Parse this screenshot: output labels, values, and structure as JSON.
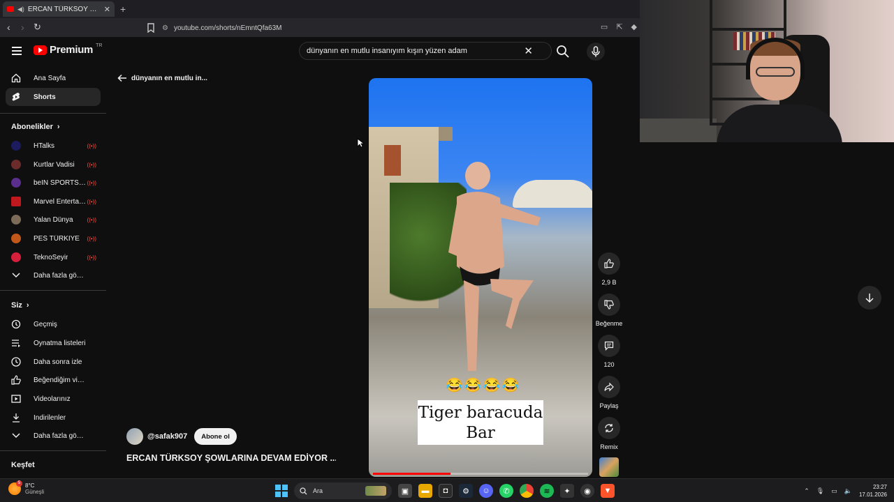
{
  "browser": {
    "tab_title": "ERCAN TÜRKSOY ŞOWLARINA",
    "url": "youtube.com/shorts/nEmntQfa63M"
  },
  "header": {
    "logo_text": "Premium",
    "logo_region": "TR",
    "search_value": "dünyanın en mutlu insanıyım kışın yüzen adam"
  },
  "sidebar": {
    "main": [
      {
        "label": "Ana Sayfa"
      },
      {
        "label": "Shorts"
      }
    ],
    "subs_heading": "Abonelikler",
    "subscriptions": [
      {
        "label": "HTalks",
        "color": "#1b1b5e"
      },
      {
        "label": "Kurtlar Vadisi",
        "color": "#6b2b2b"
      },
      {
        "label": "beIN SPORTS TÜ...",
        "color": "#5a2e8c"
      },
      {
        "label": "Marvel Entertain...",
        "color": "#c0181f"
      },
      {
        "label": "Yalan Dünya",
        "color": "#7d6b5a"
      },
      {
        "label": "PES TÜRKİYE",
        "color": "#c2571a"
      },
      {
        "label": "TeknoSeyir",
        "color": "#d61f3b"
      }
    ],
    "subs_more": "Daha fazla göster",
    "you_heading": "Siz",
    "you": [
      {
        "label": "Geçmiş"
      },
      {
        "label": "Oynatma listeleri"
      },
      {
        "label": "Daha sonra izle"
      },
      {
        "label": "Beğendiğim videolar"
      },
      {
        "label": "Videolarınız"
      },
      {
        "label": "İndirilenler"
      }
    ],
    "you_more": "Daha fazla göster",
    "explore_heading": "Keşfet"
  },
  "shorts": {
    "back_label": "dünyanın en mutlu in...",
    "caption_line1": "Tiger baracuda",
    "caption_line2": "Bar",
    "emoji": "😂😂😂😂",
    "progress": 0.36,
    "like_count": "2,9 B",
    "dislike_label": "Beğenme",
    "comment_count": "120",
    "share_label": "Paylaş",
    "remix_label": "Remix",
    "channel_name": "@safak907",
    "subscribe_label": "Abone ol",
    "title": "ERCAN TÜRKSOY ŞOWLARINA DEVAM EDİYOR ..."
  },
  "taskbar": {
    "temp": "8°C",
    "weather": "Güneşli",
    "weather_badge": "5",
    "search_label": "Ara",
    "time": "23:27",
    "date": "17.01.2026"
  }
}
